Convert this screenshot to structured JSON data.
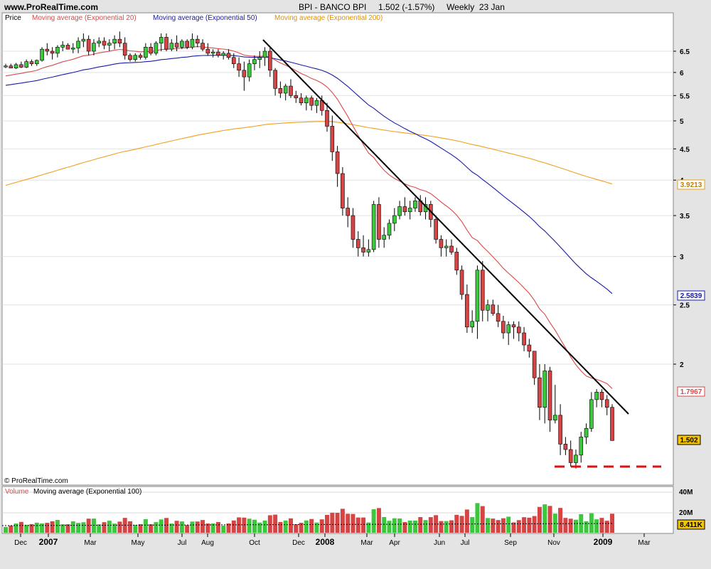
{
  "header": {
    "site": "www.ProRealTime.com",
    "title": "BPI - BANCO BPI     1.502 (-1.57%)     Weekly  23 Jan"
  },
  "legend": {
    "price": "Price",
    "ema20": "Moving average (Exponential 20)",
    "ema50": "Moving average (Exponential 50)",
    "ema200": "Moving average (Exponential 200)",
    "volume": "Volume",
    "vol_ema": "Moving average (Exponential 100)"
  },
  "copyright": "© ProRealTime.com",
  "colors": {
    "ema20": "#d94a4a",
    "ema50": "#1a1aa6",
    "ema200": "#f0a020",
    "up": "#3cc83c",
    "down": "#d64545",
    "trendline": "#000000",
    "support": "#e01010"
  },
  "x_labels": [
    "Dec",
    "2007",
    "Mar",
    "May",
    "Jul",
    "Aug",
    "Oct",
    "Dec",
    "2008",
    "Mar",
    "Apr",
    "Jun",
    "Jul",
    "Sep",
    "Nov",
    "2009",
    "Mar"
  ],
  "price_ticks": [
    "6.5",
    "6",
    "5.5",
    "5",
    "4.5",
    "4",
    "3.5",
    "3",
    "2.5",
    "2"
  ],
  "volume_ticks": [
    "40M",
    "20M"
  ],
  "price_badges": {
    "ema200": "3.9213",
    "ema50": "2.5839",
    "ema20": "1.7967",
    "last": "1.502",
    "volume": "8.411K"
  },
  "chart_data": {
    "type": "candlestick",
    "title": "BPI - BANCO BPI",
    "period": "Weekly",
    "yscale": "log",
    "ylim": [
      1.3,
      7.2
    ],
    "series": [
      {
        "name": "Price",
        "ohlc_weekly": [
          [
            6.15,
            6.2,
            6.1,
            6.15
          ],
          [
            6.15,
            6.2,
            6.1,
            6.1
          ],
          [
            6.1,
            6.22,
            6.08,
            6.18
          ],
          [
            6.18,
            6.25,
            6.1,
            6.12
          ],
          [
            6.12,
            6.3,
            6.1,
            6.25
          ],
          [
            6.25,
            6.3,
            6.15,
            6.2
          ],
          [
            6.2,
            6.3,
            6.15,
            6.28
          ],
          [
            6.28,
            6.6,
            6.25,
            6.55
          ],
          [
            6.55,
            6.7,
            6.4,
            6.5
          ],
          [
            6.5,
            6.6,
            6.3,
            6.45
          ],
          [
            6.45,
            6.65,
            6.35,
            6.6
          ],
          [
            6.6,
            6.75,
            6.5,
            6.65
          ],
          [
            6.65,
            6.7,
            6.55,
            6.55
          ],
          [
            6.55,
            6.7,
            6.45,
            6.58
          ],
          [
            6.58,
            6.85,
            6.45,
            6.75
          ],
          [
            6.75,
            6.95,
            6.6,
            6.8
          ],
          [
            6.8,
            6.9,
            6.4,
            6.5
          ],
          [
            6.5,
            6.8,
            6.4,
            6.7
          ],
          [
            6.7,
            6.85,
            6.6,
            6.75
          ],
          [
            6.75,
            6.85,
            6.55,
            6.65
          ],
          [
            6.65,
            6.8,
            6.5,
            6.7
          ],
          [
            6.7,
            6.9,
            6.55,
            6.8
          ],
          [
            6.8,
            7.0,
            6.6,
            6.7
          ],
          [
            6.7,
            6.85,
            6.3,
            6.4
          ],
          [
            6.4,
            6.45,
            6.25,
            6.3
          ],
          [
            6.3,
            6.45,
            6.25,
            6.4
          ],
          [
            6.4,
            6.45,
            6.3,
            6.35
          ],
          [
            6.35,
            6.7,
            6.3,
            6.6
          ],
          [
            6.6,
            6.7,
            6.4,
            6.45
          ],
          [
            6.45,
            6.75,
            6.4,
            6.7
          ],
          [
            6.7,
            6.95,
            6.5,
            6.85
          ],
          [
            6.85,
            6.95,
            6.5,
            6.55
          ],
          [
            6.55,
            6.8,
            6.5,
            6.7
          ],
          [
            6.7,
            6.9,
            6.5,
            6.6
          ],
          [
            6.6,
            6.8,
            6.55,
            6.75
          ],
          [
            6.75,
            6.8,
            6.55,
            6.6
          ],
          [
            6.6,
            6.95,
            6.55,
            6.8
          ],
          [
            6.8,
            6.9,
            6.6,
            6.7
          ],
          [
            6.7,
            6.8,
            6.5,
            6.55
          ],
          [
            6.55,
            6.7,
            6.4,
            6.45
          ],
          [
            6.45,
            6.55,
            6.35,
            6.48
          ],
          [
            6.48,
            6.55,
            6.35,
            6.4
          ],
          [
            6.4,
            6.5,
            6.3,
            6.45
          ],
          [
            6.45,
            6.55,
            6.3,
            6.35
          ],
          [
            6.35,
            6.45,
            6.1,
            6.2
          ],
          [
            6.2,
            6.35,
            5.9,
            6.05
          ],
          [
            6.05,
            6.25,
            5.6,
            5.9
          ],
          [
            5.9,
            6.3,
            5.8,
            6.2
          ],
          [
            6.2,
            6.4,
            6.05,
            6.3
          ],
          [
            6.3,
            6.5,
            6.1,
            6.35
          ],
          [
            6.35,
            6.6,
            6.15,
            6.5
          ],
          [
            6.5,
            6.6,
            5.9,
            6.05
          ],
          [
            6.05,
            6.1,
            5.5,
            5.65
          ],
          [
            5.65,
            5.8,
            5.45,
            5.55
          ],
          [
            5.55,
            5.75,
            5.4,
            5.7
          ],
          [
            5.7,
            5.85,
            5.45,
            5.5
          ],
          [
            5.5,
            5.6,
            5.35,
            5.45
          ],
          [
            5.45,
            5.55,
            5.3,
            5.35
          ],
          [
            5.35,
            5.5,
            5.2,
            5.45
          ],
          [
            5.45,
            5.5,
            5.2,
            5.3
          ],
          [
            5.3,
            5.45,
            5.15,
            5.4
          ],
          [
            5.4,
            5.5,
            5.1,
            5.2
          ],
          [
            5.2,
            5.35,
            4.8,
            4.9
          ],
          [
            4.9,
            5.1,
            4.3,
            4.45
          ],
          [
            4.45,
            4.55,
            3.9,
            4.1
          ],
          [
            4.1,
            4.2,
            3.5,
            3.6
          ],
          [
            3.6,
            3.75,
            3.35,
            3.5
          ],
          [
            3.5,
            3.6,
            3.1,
            3.2
          ],
          [
            3.2,
            3.3,
            3.0,
            3.1
          ],
          [
            3.1,
            3.25,
            3.0,
            3.05
          ],
          [
            3.05,
            3.2,
            3.0,
            3.08
          ],
          [
            3.08,
            3.7,
            3.05,
            3.65
          ],
          [
            3.65,
            3.75,
            3.1,
            3.2
          ],
          [
            3.2,
            3.35,
            3.1,
            3.25
          ],
          [
            3.25,
            3.45,
            3.2,
            3.4
          ],
          [
            3.4,
            3.6,
            3.3,
            3.5
          ],
          [
            3.5,
            3.7,
            3.45,
            3.62
          ],
          [
            3.62,
            3.75,
            3.5,
            3.55
          ],
          [
            3.55,
            3.7,
            3.45,
            3.6
          ],
          [
            3.6,
            3.75,
            3.55,
            3.7
          ],
          [
            3.7,
            3.78,
            3.5,
            3.55
          ],
          [
            3.55,
            3.75,
            3.45,
            3.65
          ],
          [
            3.65,
            3.7,
            3.35,
            3.45
          ],
          [
            3.45,
            3.5,
            3.15,
            3.2
          ],
          [
            3.2,
            3.25,
            3.0,
            3.1
          ],
          [
            3.1,
            3.2,
            3.0,
            3.12
          ],
          [
            3.12,
            3.2,
            3.02,
            3.05
          ],
          [
            3.05,
            3.1,
            2.8,
            2.85
          ],
          [
            2.85,
            2.9,
            2.55,
            2.6
          ],
          [
            2.6,
            2.7,
            2.25,
            2.3
          ],
          [
            2.3,
            2.45,
            2.25,
            2.35
          ],
          [
            2.35,
            2.9,
            2.2,
            2.85
          ],
          [
            2.85,
            2.95,
            2.35,
            2.45
          ],
          [
            2.45,
            2.55,
            2.35,
            2.5
          ],
          [
            2.5,
            2.55,
            2.4,
            2.42
          ],
          [
            2.42,
            2.5,
            2.3,
            2.35
          ],
          [
            2.35,
            2.4,
            2.2,
            2.25
          ],
          [
            2.25,
            2.35,
            2.15,
            2.32
          ],
          [
            2.32,
            2.35,
            2.2,
            2.3
          ],
          [
            2.3,
            2.35,
            2.18,
            2.25
          ],
          [
            2.25,
            2.3,
            2.1,
            2.15
          ],
          [
            2.15,
            2.2,
            2.05,
            2.1
          ],
          [
            2.1,
            2.1,
            1.85,
            1.9
          ],
          [
            1.9,
            2.0,
            1.62,
            1.7
          ],
          [
            1.7,
            2.0,
            1.6,
            1.95
          ],
          [
            1.95,
            1.98,
            1.55,
            1.62
          ],
          [
            1.62,
            1.85,
            1.6,
            1.65
          ],
          [
            1.65,
            1.72,
            1.42,
            1.48
          ],
          [
            1.48,
            1.52,
            1.42,
            1.45
          ],
          [
            1.45,
            1.5,
            1.36,
            1.38
          ],
          [
            1.38,
            1.45,
            1.35,
            1.42
          ],
          [
            1.42,
            1.55,
            1.38,
            1.52
          ],
          [
            1.52,
            1.6,
            1.48,
            1.57
          ],
          [
            1.57,
            1.8,
            1.55,
            1.75
          ],
          [
            1.75,
            1.82,
            1.7,
            1.8
          ],
          [
            1.8,
            1.82,
            1.7,
            1.75
          ],
          [
            1.75,
            1.78,
            1.65,
            1.7
          ],
          [
            1.7,
            1.72,
            1.5,
            1.5
          ]
        ]
      },
      {
        "name": "Moving average (Exponential 20)",
        "last": 1.7967
      },
      {
        "name": "Moving average (Exponential 50)",
        "last": 2.5839
      },
      {
        "name": "Moving average (Exponential 200)",
        "last": 3.9213
      },
      {
        "name": "Volume",
        "last": "8.411K"
      }
    ],
    "annotations": [
      "descending trendline",
      "support line"
    ]
  }
}
